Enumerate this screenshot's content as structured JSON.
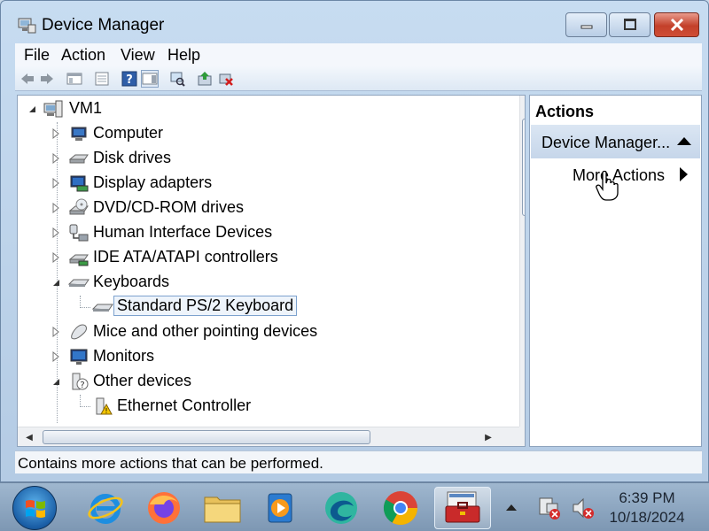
{
  "window": {
    "title": "Device Manager",
    "icon": "device-manager-icon"
  },
  "menu": [
    "File",
    "Action",
    "View",
    "Help"
  ],
  "toolbar": [
    "back-icon",
    "forward-icon",
    "show-hide-console-tree-icon",
    "properties-icon",
    "help-icon",
    "show-hide-action-pane-icon",
    "scan-hardware-icon",
    "update-driver-icon",
    "uninstall-icon"
  ],
  "tree": {
    "root": "VM1",
    "nodes": [
      {
        "label": "Computer",
        "icon": "computer-icon",
        "expanded": false
      },
      {
        "label": "Disk drives",
        "icon": "disk-drive-icon",
        "expanded": false
      },
      {
        "label": "Display adapters",
        "icon": "display-adapter-icon",
        "expanded": false
      },
      {
        "label": "DVD/CD-ROM drives",
        "icon": "dvd-drive-icon",
        "expanded": false
      },
      {
        "label": "Human Interface Devices",
        "icon": "hid-icon",
        "expanded": false
      },
      {
        "label": "IDE ATA/ATAPI controllers",
        "icon": "ide-controller-icon",
        "expanded": false
      },
      {
        "label": "Keyboards",
        "icon": "keyboard-icon",
        "expanded": true,
        "children": [
          "Standard PS/2 Keyboard"
        ]
      },
      {
        "label": "Mice and other pointing devices",
        "icon": "mouse-icon",
        "expanded": false
      },
      {
        "label": "Monitors",
        "icon": "monitor-icon",
        "expanded": false
      },
      {
        "label": "Other devices",
        "icon": "unknown-device-icon",
        "expanded": true,
        "children": [
          "Ethernet Controller"
        ]
      }
    ],
    "selected": "Standard PS/2 Keyboard"
  },
  "actions": {
    "header": "Actions",
    "section": "Device Manager...",
    "more": "More Actions"
  },
  "status": "Contains more actions that can be performed.",
  "taskbar": {
    "apps": [
      "internet-explorer-icon",
      "firefox-icon",
      "file-explorer-icon",
      "media-player-icon",
      "edge-icon",
      "chrome-icon",
      "device-manager-toolbox-icon"
    ],
    "time": "6:39 PM",
    "date": "10/18/2024"
  },
  "colors": {
    "accent": "#c7dcf1",
    "selection": "#eef4fb"
  }
}
